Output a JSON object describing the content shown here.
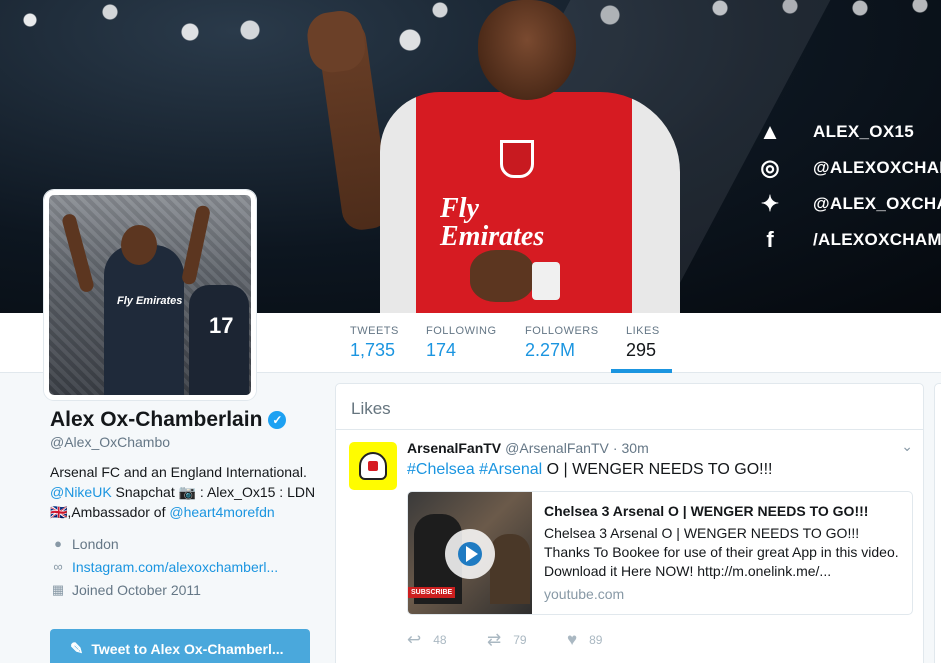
{
  "banner": {
    "socials": [
      {
        "icon": "snapchat-icon",
        "glyph": "▲",
        "text": "ALEX_OX15"
      },
      {
        "icon": "instagram-icon",
        "glyph": "◎",
        "text": "@ALEXOXCHAM"
      },
      {
        "icon": "twitter-icon",
        "glyph": "✦",
        "text": "@ALEX_OXCHA"
      },
      {
        "icon": "facebook-icon",
        "glyph": "f",
        "text": "/ALEXOXCHAM"
      }
    ],
    "jersey_sponsor": "Fly\nEmirates",
    "avatar_number": "17",
    "avatar_sponsor": "Fly Emirates"
  },
  "nav": {
    "tweets_label": "TWEETS",
    "tweets_value": "1,735",
    "following_label": "FOLLOWING",
    "following_value": "174",
    "followers_label": "FOLLOWERS",
    "followers_value": "2.27M",
    "likes_label": "LIKES",
    "likes_value": "295"
  },
  "profile": {
    "name": "Alex Ox-Chamberlain",
    "handle": "@Alex_OxChambo",
    "bio_1": "Arsenal FC and an England International. ",
    "bio_link_1": "@NikeUK",
    "bio_2": " Snapchat 📷 : Alex_Ox15 : LDN🇬🇧,Ambassador of ",
    "bio_link_2": "@heart4morefdn",
    "location": "London",
    "website": "Instagram.com/alexoxchamberl...",
    "joined": "Joined October 2011",
    "tweet_to_label": "Tweet to Alex Ox-Chamberl..."
  },
  "timeline": {
    "header": "Likes",
    "tweet": {
      "name": "ArsenalFanTV",
      "handle": "@ArsenalFanTV",
      "dot": "·",
      "time": "30m",
      "hashtag_1": "#Chelsea",
      "hashtag_2": "#Arsenal",
      "text": " O | WENGER NEEDS TO GO!!!",
      "card": {
        "thumb_label": "SUBSCRIBE",
        "title": "Chelsea 3 Arsenal O | WENGER NEEDS TO GO!!!",
        "description": "Chelsea 3 Arsenal O | WENGER NEEDS TO GO!!! Thanks To Bookee for use of their great App in this video. Download it Here NOW! http://m.onelink.me/...",
        "source": "youtube.com"
      },
      "replies": "48",
      "retweets": "79",
      "likes": "89"
    }
  },
  "colors": {
    "accent": "#1b95e0",
    "banner_dark": "#0d1620",
    "jersey_red": "#d61b22",
    "tweet_button": "#4aa8dc"
  }
}
